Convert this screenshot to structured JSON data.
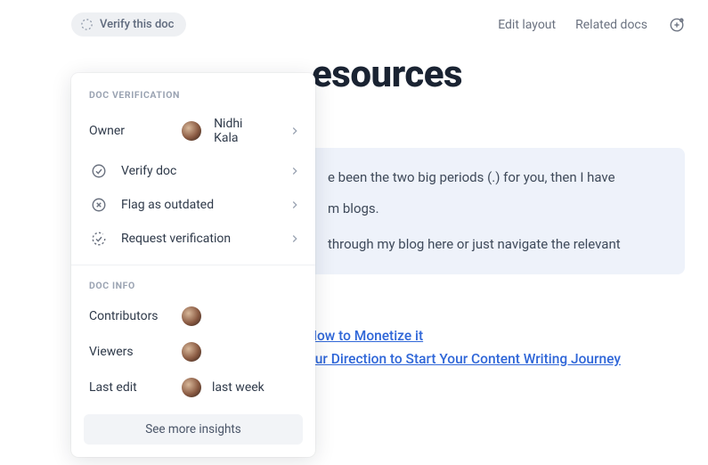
{
  "toolbar": {
    "verify_label": "Verify this doc",
    "edit_layout": "Edit layout",
    "related_docs": "Related docs"
  },
  "page": {
    "title_visible": "esources",
    "callout_line1": "e been the two big periods (.) for you, then I have",
    "callout_line2": "m blogs.",
    "callout_line3": "through my blog here or just navigate the relevant",
    "link1": "How to Monetize it",
    "link2": "our Direction to Start Your Content Writing Journey"
  },
  "panel": {
    "section1_title": "DOC VERIFICATION",
    "owner_label": "Owner",
    "owner_name": "Nidhi Kala",
    "verify_doc": "Verify doc",
    "flag_outdated": "Flag as outdated",
    "request_verification": "Request verification",
    "section2_title": "DOC INFO",
    "contributors_label": "Contributors",
    "viewers_label": "Viewers",
    "last_edit_label": "Last edit",
    "last_edit_value": "last week",
    "insights_button": "See more insights"
  }
}
